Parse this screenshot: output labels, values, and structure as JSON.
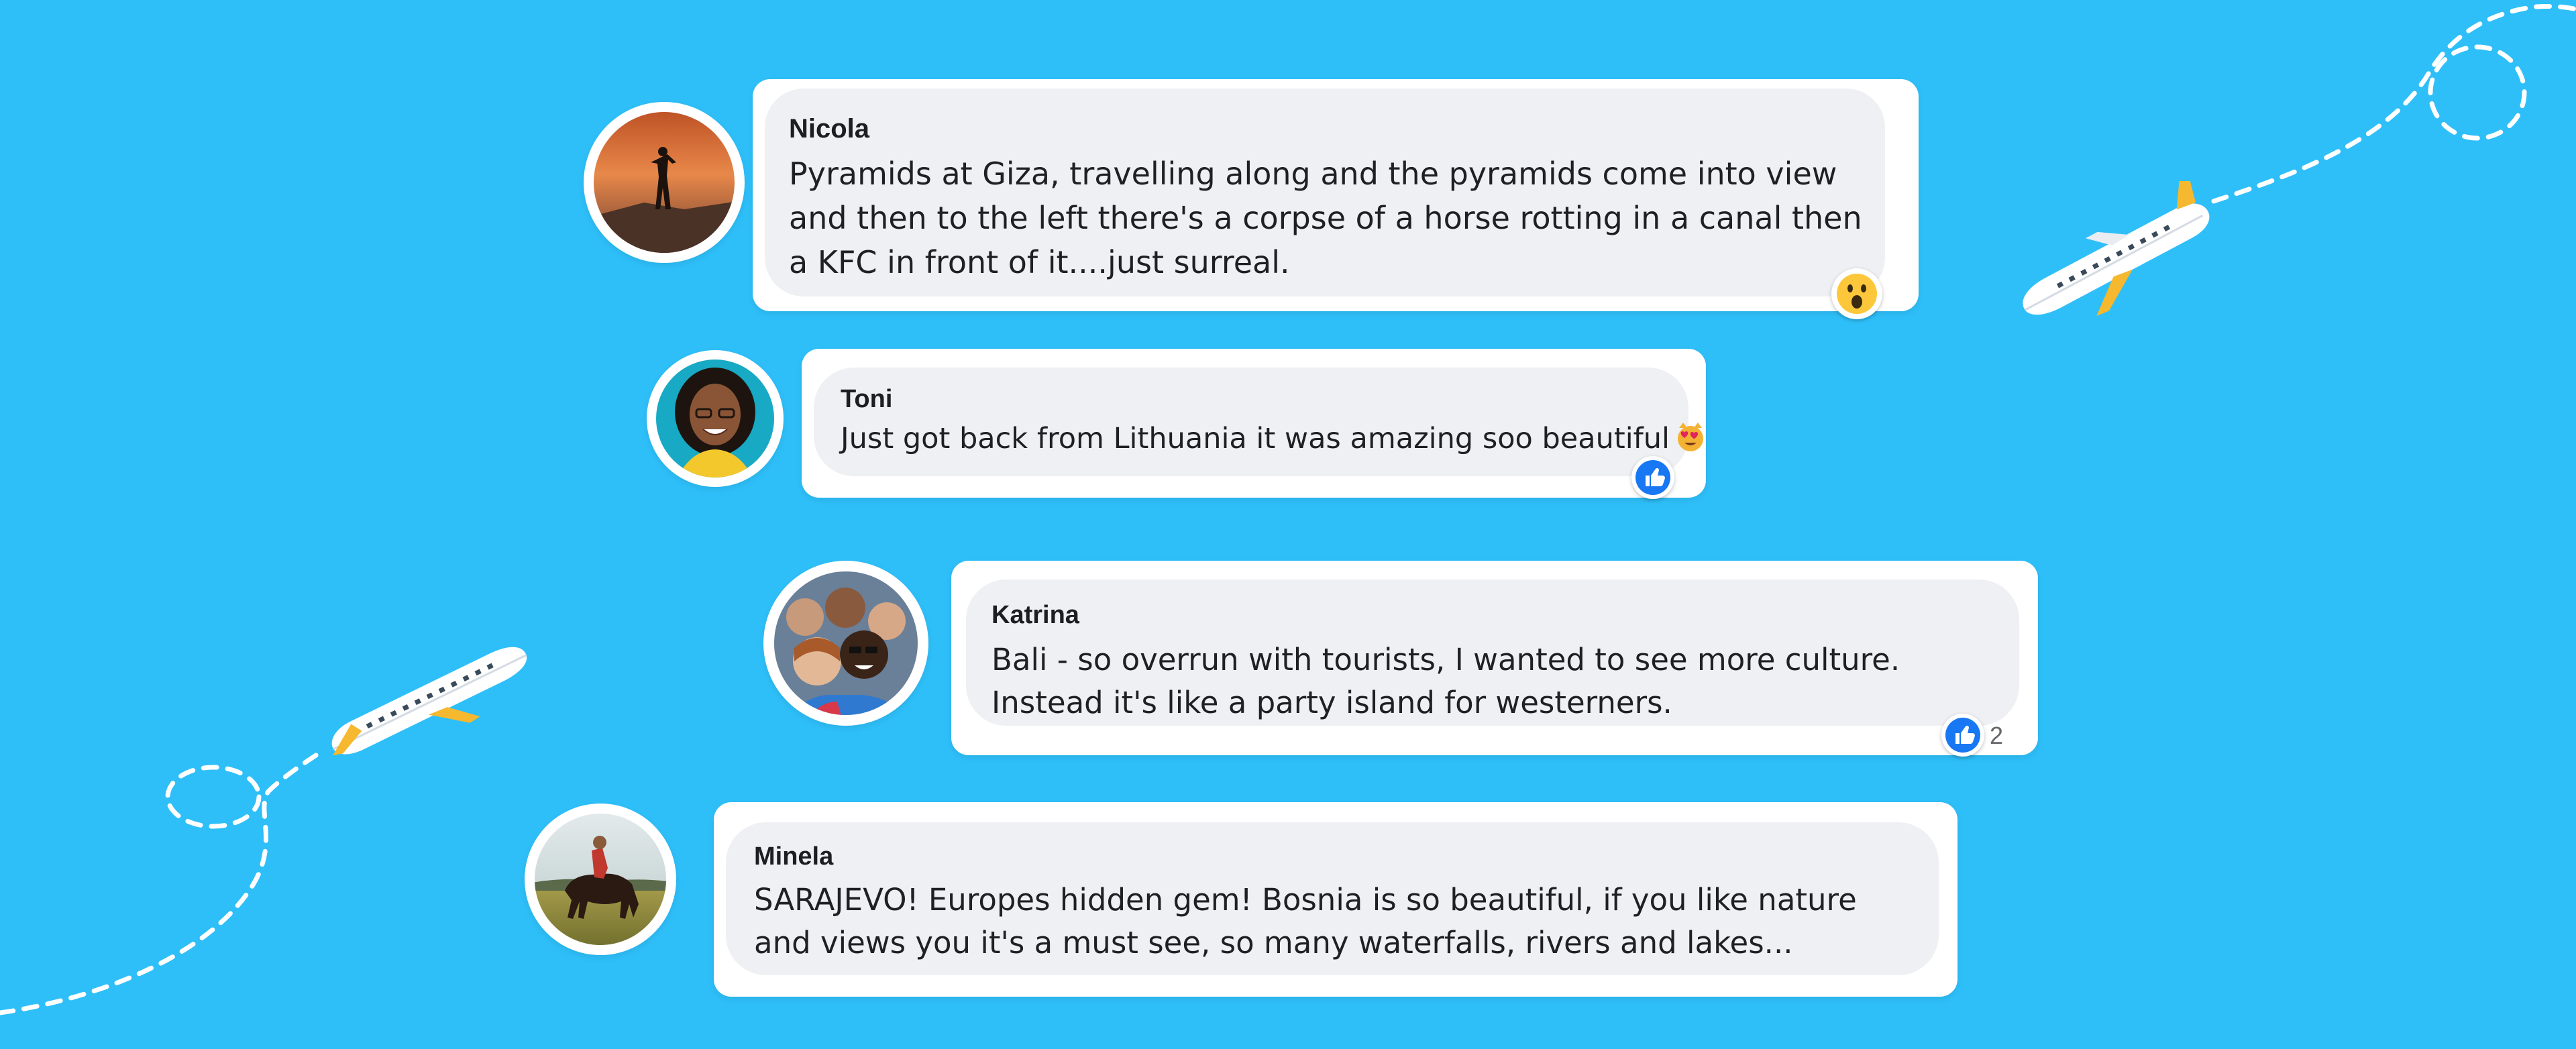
{
  "comments": [
    {
      "author": "Nicola",
      "text": "Pyramids at Giza, travelling along and the pyramids come into view and then to the left there's a corpse of a horse rotting in a canal then a KFC in front of it....just surreal.",
      "reaction": "wow-emoji",
      "avatar": "sunset-silhouette-photo"
    },
    {
      "author": "Toni",
      "text": "Just got back from Lithuania it was amazing soo beautiful",
      "inline_emoji": "heart-eyes-cat-emoji",
      "reaction": "like-emoji",
      "avatar": "smiling-woman-photo"
    },
    {
      "author": "Katrina",
      "text": "Bali - so overrun with tourists, I wanted to see more culture. Instead it's like a party island for westerners.",
      "reaction": "like-emoji",
      "reaction_count": "2",
      "avatar": "group-selfie-photo"
    },
    {
      "author": "Minela",
      "text": "SARAJEVO! Europes hidden gem! Bosnia is so beautiful, if you like nature and views you it's a must see, so many waterfalls, rivers and lakes...",
      "avatar": "horse-rider-photo"
    }
  ],
  "colors": {
    "background": "#2ebff9",
    "card": "#ffffff",
    "bubble": "#eff0f3",
    "like": "#1877f2",
    "plane_tail": "#f5b82e"
  },
  "decorations": [
    "airplane-top-right",
    "airplane-left",
    "dashed-flight-path"
  ]
}
